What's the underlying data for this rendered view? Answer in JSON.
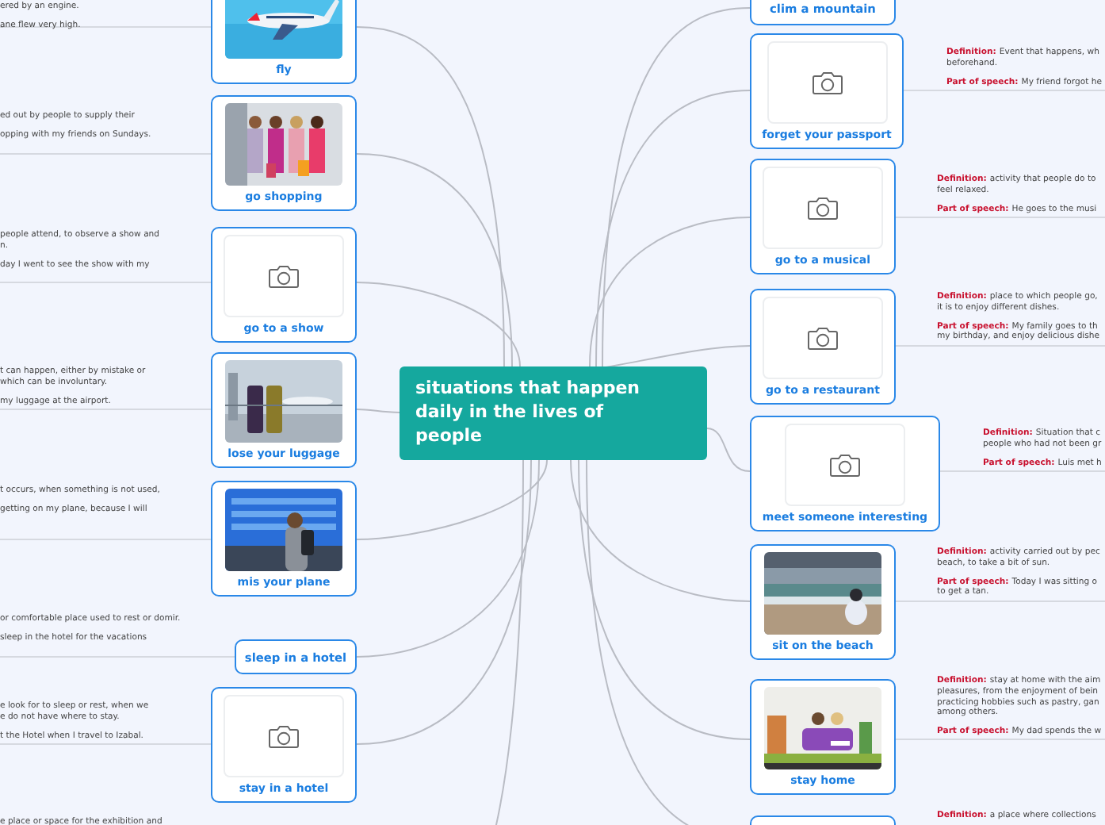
{
  "central_topic": {
    "title": "situations that happen daily in the lives of people"
  },
  "left_topics": [
    {
      "label": "fly",
      "kind": "picture",
      "notes": [
        {
          "lines": [
            "ered by an engine."
          ]
        },
        {
          "lines": [
            "ane flew very high."
          ]
        }
      ]
    },
    {
      "label": "go shopping",
      "kind": "picture",
      "notes": [
        {
          "lines": [
            "ed out by people to supply their"
          ]
        },
        {
          "lines": [
            "opping with my friends on Sundays."
          ]
        }
      ]
    },
    {
      "label": "go to a show",
      "kind": "placeholder",
      "notes": [
        {
          "lines": [
            "people attend, to observe a show and",
            "n."
          ]
        },
        {
          "lines": [
            "day I went to see the show with my"
          ]
        }
      ]
    },
    {
      "label": "lose your luggage",
      "kind": "picture",
      "notes": [
        {
          "lines": [
            "t can happen, either by mistake or",
            "which can be involuntary."
          ]
        },
        {
          "lines": [
            "my luggage at the airport."
          ]
        }
      ]
    },
    {
      "label": "mis your plane",
      "kind": "picture",
      "notes": [
        {
          "lines": [
            "t occurs, when something is not used,"
          ]
        },
        {
          "lines": [
            "getting on my plane, because I will"
          ]
        }
      ]
    },
    {
      "label": "sleep in a hotel",
      "kind": "text",
      "notes": [
        {
          "lines": [
            "or comfortable place used to rest or domir."
          ]
        },
        {
          "lines": [
            "sleep in the hotel for the vacations"
          ]
        }
      ]
    },
    {
      "label": "stay in a hotel",
      "kind": "placeholder",
      "notes": [
        {
          "lines": [
            "e look for to sleep or rest, when we",
            "e do not have where to stay."
          ]
        },
        {
          "lines": [
            "t the Hotel when I travel to Izabal."
          ]
        }
      ]
    },
    {
      "notes": [
        {
          "lines": [
            "e place or space for the exhibition and"
          ]
        }
      ]
    }
  ],
  "right_topics": [
    {
      "label": "clim a mountain",
      "kind": "text"
    },
    {
      "label": "forget your passport",
      "kind": "placeholder",
      "notes": [
        {
          "label": "Definition:",
          "lines": [
            "Event that happens, wh",
            "beforehand."
          ]
        },
        {
          "label": "Part of speech:",
          "lines": [
            "My friend forgot he"
          ]
        }
      ]
    },
    {
      "label": "go to a musical",
      "kind": "placeholder",
      "notes": [
        {
          "label": "Definition:",
          "lines": [
            "activity that people do to",
            "feel relaxed."
          ]
        },
        {
          "label": "Part of speech:",
          "lines": [
            "He goes to the musi"
          ]
        }
      ]
    },
    {
      "label": "go  to a restaurant",
      "kind": "placeholder",
      "notes": [
        {
          "label": "Definition:",
          "lines": [
            "place to which people go,",
            "it is to enjoy different dishes."
          ]
        },
        {
          "label": "Part of speech:",
          "lines": [
            "My family goes to th",
            "my birthday, and enjoy delicious dishe"
          ]
        }
      ]
    },
    {
      "label": "meet someone interesting",
      "kind": "placeholder",
      "notes": [
        {
          "label": "Definition:",
          "lines": [
            "Situation that c",
            "people who had not been gr"
          ]
        },
        {
          "label": "Part of speech:",
          "lines": [
            "Luis met h"
          ]
        }
      ]
    },
    {
      "label": "sit on the beach",
      "kind": "picture",
      "notes": [
        {
          "label": "Definition:",
          "lines": [
            "activity carried out by pec",
            "beach, to take a bit of sun."
          ]
        },
        {
          "label": "Part of speech:",
          "lines": [
            "Today I was sitting o",
            "to get a tan."
          ]
        }
      ]
    },
    {
      "label": "stay home",
      "kind": "picture",
      "notes": [
        {
          "label": "Definition:",
          "lines": [
            "stay at home with the aim",
            "pleasures, from the enjoyment of bein",
            "practicing hobbies such as pastry, gan",
            "among others."
          ]
        },
        {
          "label": "Part of speech:",
          "lines": [
            "My dad spends the w"
          ]
        }
      ]
    },
    {
      "kind": "text",
      "notes": [
        {
          "label": "Definition:",
          "lines": [
            "a place where collections"
          ]
        }
      ]
    }
  ]
}
